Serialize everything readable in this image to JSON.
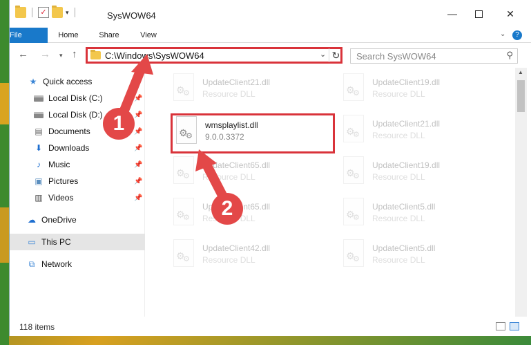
{
  "window": {
    "title": "SysWOW64",
    "minimize_glyph": "—",
    "close_glyph": "✕"
  },
  "ribbon": {
    "tabs": [
      {
        "label": "File"
      },
      {
        "label": "Home"
      },
      {
        "label": "Share"
      },
      {
        "label": "View"
      }
    ],
    "help_glyph": "?"
  },
  "navbar": {
    "back_glyph": "←",
    "forward_glyph": "→",
    "up_glyph": "↑",
    "address": "C:\\Windows\\SysWOW64",
    "search_placeholder": "Search SysWOW64"
  },
  "sidebar": {
    "items": [
      {
        "label": "Quick access",
        "icon": "star-icon",
        "pinned": false
      },
      {
        "label": "Local Disk (C:)",
        "icon": "disk-icon",
        "pinned": true
      },
      {
        "label": "Local Disk (D:)",
        "icon": "disk-icon",
        "pinned": true
      },
      {
        "label": "Documents",
        "icon": "document-icon",
        "pinned": true
      },
      {
        "label": "Downloads",
        "icon": "download-icon",
        "pinned": true
      },
      {
        "label": "Music",
        "icon": "music-icon",
        "pinned": true
      },
      {
        "label": "Pictures",
        "icon": "pictures-icon",
        "pinned": true
      },
      {
        "label": "Videos",
        "icon": "video-icon",
        "pinned": true
      },
      {
        "label": "OneDrive",
        "icon": "cloud-icon",
        "pinned": false
      },
      {
        "label": "This PC",
        "icon": "computer-icon",
        "selected": true
      },
      {
        "label": "Network",
        "icon": "network-icon",
        "pinned": false
      }
    ]
  },
  "files": {
    "highlighted": {
      "name": "wmsplaylist.dll",
      "detail": "9.0.0.3372"
    },
    "background": [
      {
        "name": "UpdateClient21.dll",
        "detail": "Resource DLL"
      },
      {
        "name": "UpdateClient19.dll",
        "detail": "Resource DLL"
      },
      {
        "name": "UpdateClient21.dll",
        "detail": "Resource DLL"
      },
      {
        "name": "UpdateClient65.dll",
        "detail": "Resource DLL"
      },
      {
        "name": "UpdateClient19.dll",
        "detail": "Resource DLL"
      },
      {
        "name": "UpdateClient65.dll",
        "detail": "Resource DLL"
      },
      {
        "name": "UpdateClient5.dll",
        "detail": "Resource DLL"
      },
      {
        "name": "UpdateClient42.dll",
        "detail": "Resource DLL"
      },
      {
        "name": "UpdateClient5.dll",
        "detail": "Resource DLL"
      }
    ]
  },
  "status": {
    "item_count": "118 items"
  },
  "annotations": {
    "step1": "1",
    "step2": "2",
    "highlight_color": "#d9333a",
    "callout_color": "#e34848"
  }
}
